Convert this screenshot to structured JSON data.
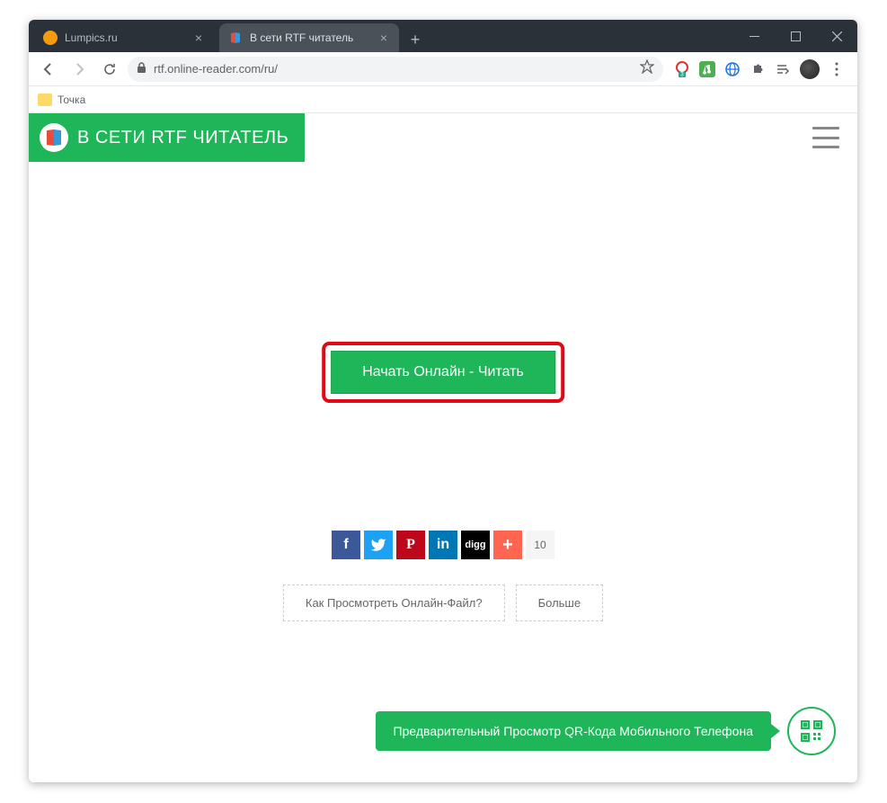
{
  "window": {
    "tabs": [
      {
        "title": "Lumpics.ru",
        "active": false
      },
      {
        "title": "В сети RTF читатель",
        "active": true
      }
    ]
  },
  "addressbar": {
    "url": "rtf.online-reader.com/ru/"
  },
  "bookmarks": {
    "item0": "Точка"
  },
  "site": {
    "logo_text": "В СЕТИ RTF ЧИТАТЕЛЬ"
  },
  "cta": {
    "label": "Начать Онлайн - Читать"
  },
  "social": {
    "fb": "f",
    "tw": "🐦",
    "pin": "P",
    "li": "in",
    "digg": "digg",
    "plus": "+",
    "count": "10"
  },
  "links": {
    "howto": "Как Просмотреть Онлайн-Файл?",
    "more": "Больше"
  },
  "qr": {
    "banner_text": "Предварительный Просмотр QR-Кода Мобильного Телефона"
  }
}
